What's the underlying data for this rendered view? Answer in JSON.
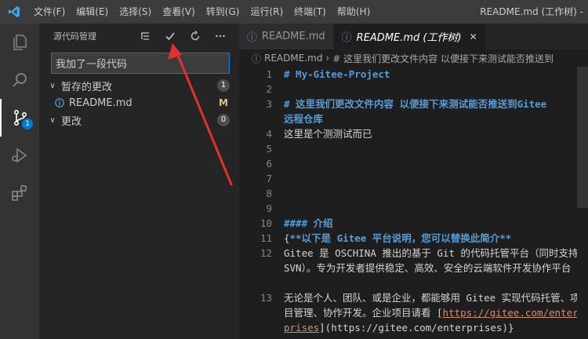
{
  "menu": [
    "文件(F)",
    "编辑(E)",
    "选择(S)",
    "查看(V)",
    "转到(G)",
    "运行(R)",
    "终端(T)",
    "帮助(H)"
  ],
  "window_title": "README.md (工作树) - ",
  "activity": {
    "scm_badge": "1"
  },
  "sidebar": {
    "title": "源代码管理",
    "commit_message": "我加了一段代码",
    "staged_label": "暂存的更改",
    "staged_count": "1",
    "staged_file": "README.md",
    "staged_file_status": "M",
    "changes_label": "更改",
    "changes_count": "0"
  },
  "tabs": [
    {
      "label": "README.md",
      "active": false
    },
    {
      "label": "README.md (工作树)",
      "active": true
    }
  ],
  "breadcrumb": {
    "file": "README.md",
    "heading": "# 这里我们更改文件内容 以便接下来测试能否推送到"
  },
  "code": {
    "l1": "# My-Gitee-Project",
    "l3a": "# 这里我们更改文件内容 以便接下来测试能否推送到Gitee",
    "l3b": "远程仓库",
    "l4": "这里是个测测试而已",
    "l10": "#### 介绍",
    "l11_prefix": "{",
    "l11": "**以下是 Gitee 平台说明，您可以替换此简介**",
    "l12": "Gitee 是 OSCHINA 推出的基于 Git 的代码托管平台（同时支持 SVN）。专为开发者提供稳定、高效、安全的云端软件开发协作平台",
    "l13_prefix": "无论是个人、团队、或是企业，都能够用 Gitee 实现代码托管、项目管理、协作开发。企业项目请看 [",
    "l13_link": "https://gitee.com/enterprises",
    "l13_suffix": "](https://gitee.com/enterprises)}",
    "numbers": [
      "1",
      "2",
      "3",
      "4",
      "5",
      "6",
      "7",
      "8",
      "9",
      "10",
      "11",
      "12",
      "13"
    ]
  }
}
